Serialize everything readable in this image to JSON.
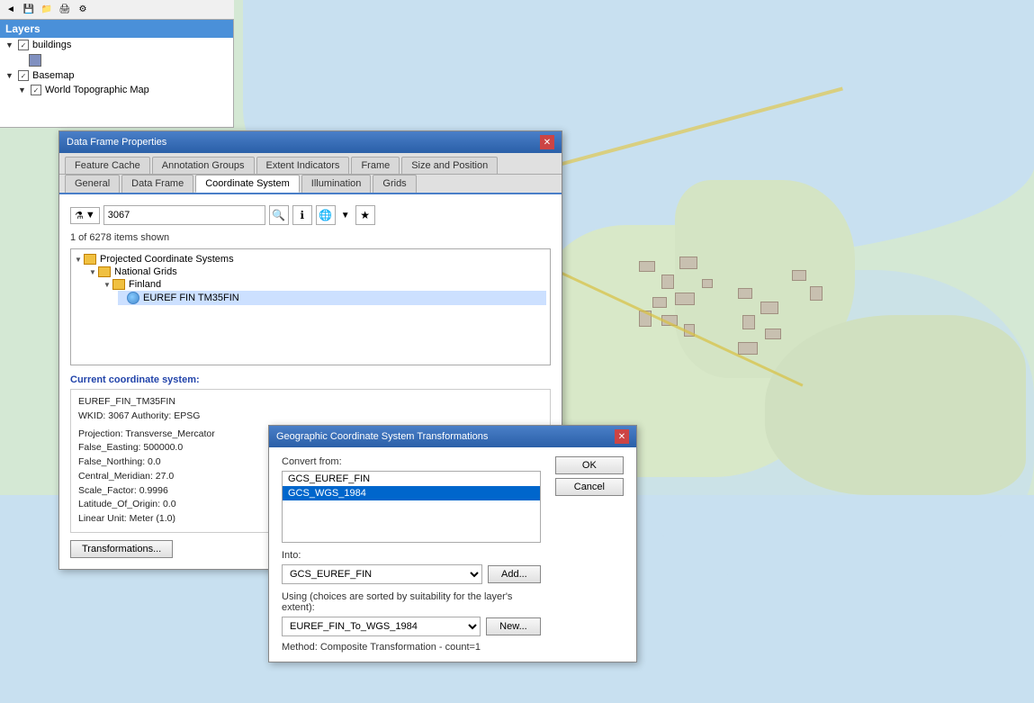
{
  "app": {
    "title": "Layers",
    "toolbar_icons": [
      "arrow-icon",
      "zoom-icon",
      "pan-icon",
      "identify-icon",
      "measure-icon"
    ]
  },
  "layer_panel": {
    "title": "Layers",
    "items": [
      {
        "name": "buildings",
        "checked": true,
        "indent": 1,
        "has_expand": true,
        "color": "#6080b0"
      },
      {
        "name": "color_swatch",
        "checked": false,
        "indent": 2
      },
      {
        "name": "Basemap",
        "checked": true,
        "indent": 1,
        "has_expand": true
      },
      {
        "name": "World Topographic Map",
        "checked": true,
        "indent": 2,
        "has_expand": true
      }
    ]
  },
  "data_frame_dialog": {
    "title": "Data Frame Properties",
    "tabs_row1": [
      {
        "id": "feature-cache",
        "label": "Feature Cache"
      },
      {
        "id": "annotation-groups",
        "label": "Annotation Groups"
      },
      {
        "id": "extent-indicators",
        "label": "Extent Indicators"
      },
      {
        "id": "frame",
        "label": "Frame"
      },
      {
        "id": "size-and-position",
        "label": "Size and Position"
      }
    ],
    "tabs_row2": [
      {
        "id": "general",
        "label": "General"
      },
      {
        "id": "data-frame",
        "label": "Data Frame"
      },
      {
        "id": "coordinate-system",
        "label": "Coordinate System",
        "active": true
      },
      {
        "id": "illumination",
        "label": "Illumination"
      },
      {
        "id": "grids",
        "label": "Grids"
      }
    ],
    "search_value": "3067",
    "items_count": "1 of 6278 items shown",
    "tree": {
      "items": [
        {
          "level": 1,
          "type": "folder",
          "label": "Projected Coordinate Systems",
          "expanded": true
        },
        {
          "level": 2,
          "type": "folder",
          "label": "National Grids",
          "expanded": true
        },
        {
          "level": 3,
          "type": "folder",
          "label": "Finland",
          "expanded": true
        },
        {
          "level": 4,
          "type": "globe",
          "label": "EUREF FIN TM35FIN"
        }
      ]
    },
    "current_cs_label": "Current coordinate system:",
    "cs_info": {
      "name": "EUREF_FIN_TM35FIN",
      "wkid": "WKID: 3067 Authority: EPSG",
      "projection": "Projection: Transverse_Mercator",
      "false_easting": "False_Easting: 500000.0",
      "false_northing": "False_Northing: 0.0",
      "central_meridian": "Central_Meridian: 27.0",
      "scale_factor": "Scale_Factor: 0.9996",
      "latitude_of_origin": "Latitude_Of_Origin: 0.0",
      "linear_unit": "Linear Unit: Meter (1.0)"
    },
    "transformations_button": "Transformations..."
  },
  "geo_transform_dialog": {
    "title": "Geographic Coordinate System Transformations",
    "convert_from_label": "Convert from:",
    "convert_items": [
      {
        "label": "GCS_EUREF_FIN",
        "selected": false
      },
      {
        "label": "GCS_WGS_1984",
        "selected": true
      }
    ],
    "into_label": "Into:",
    "into_value": "GCS_EUREF_FIN",
    "add_button": "Add...",
    "using_label": "Using (choices are sorted by suitability for the layer's extent):",
    "using_value": "EUREF_FIN_To_WGS_1984",
    "new_button": "New...",
    "method_label": "Method:",
    "method_value": "Composite Transformation - count=1",
    "ok_button": "OK",
    "cancel_button": "Cancel"
  }
}
